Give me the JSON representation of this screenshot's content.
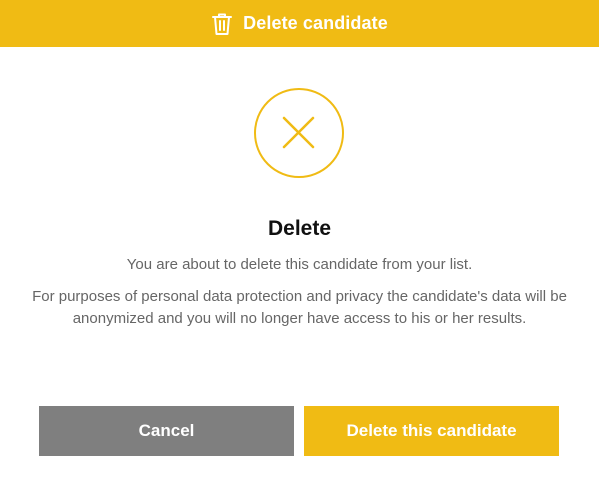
{
  "header": {
    "icon": "trash-icon",
    "title": "Delete candidate"
  },
  "status_icon": "close-circle-icon",
  "body": {
    "heading": "Delete",
    "message": "You are about to delete this candidate from your list.",
    "notice": "For purposes of personal data protection and privacy the candidate's data will be anonymized and you will no longer have access to his or her results."
  },
  "actions": {
    "cancel_label": "Cancel",
    "confirm_label": "Delete this candidate"
  },
  "colors": {
    "accent": "#f0bb14",
    "cancel": "#7f7f7f",
    "heading_text": "#111111",
    "body_text": "#666666"
  }
}
